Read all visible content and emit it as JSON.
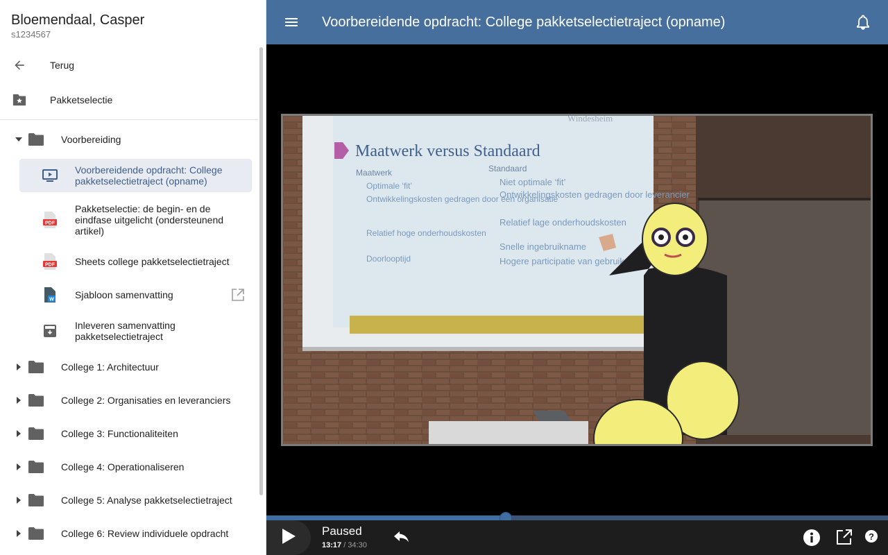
{
  "user": {
    "name": "Bloemendaal, Casper",
    "id": "s1234567"
  },
  "nav": {
    "back_label": "Terug",
    "package_label": "Pakketselectie"
  },
  "tree": {
    "open_folder": "Voorbereiding",
    "items": [
      {
        "label": "Voorbereidende opdracht: College pakketselectietraject (opname)",
        "icon": "video-icon",
        "active": true
      },
      {
        "label": "Pakketselectie: de begin- en de eindfase uitgelicht (ondersteunend artikel)",
        "icon": "pdf-icon"
      },
      {
        "label": "Sheets college pakketselectietraject",
        "icon": "pdf-icon"
      },
      {
        "label": "Sjabloon samenvatting",
        "icon": "word-icon"
      },
      {
        "label": "Inleveren samenvatting pakketselectietraject",
        "icon": "assignment-icon"
      }
    ],
    "closed_folders": [
      "College 1: Architectuur",
      "College 2: Organisaties en leveranciers",
      "College 3: Functionaliteiten",
      "College 4: Operationaliseren",
      "College 5: Analyse pakketselectietraject",
      "College 6: Review individuele opdracht"
    ]
  },
  "header": {
    "title": "Voorbereidende opdracht: College pakketselectietraject (opname)"
  },
  "slide": {
    "title": "Maatwerk versus Standaard",
    "brand": "Windesheim",
    "left_heading": "Maatwerk",
    "left_items": [
      "Optimale ‘fit’",
      "Ontwikkelingskosten gedragen door één organisatie",
      "Relatief hoge onderhoudskosten",
      "Doorlooptijd"
    ],
    "right_heading": "Standaard",
    "right_items": [
      "Niet optimale ‘fit’",
      "Ontwikkelingskosten gedragen door leverancier",
      "Relatief lage onderhoudskosten",
      "Snelle ingebruikname",
      "Hogere participatie van gebruikers"
    ]
  },
  "player": {
    "status": "Paused",
    "current_time": "13:17",
    "duration": "/ 34:30",
    "progress_fraction": 0.385
  },
  "colors": {
    "header": "#466f9d",
    "accent": "#3f6ea3",
    "active_bg": "#e8ebf1"
  }
}
